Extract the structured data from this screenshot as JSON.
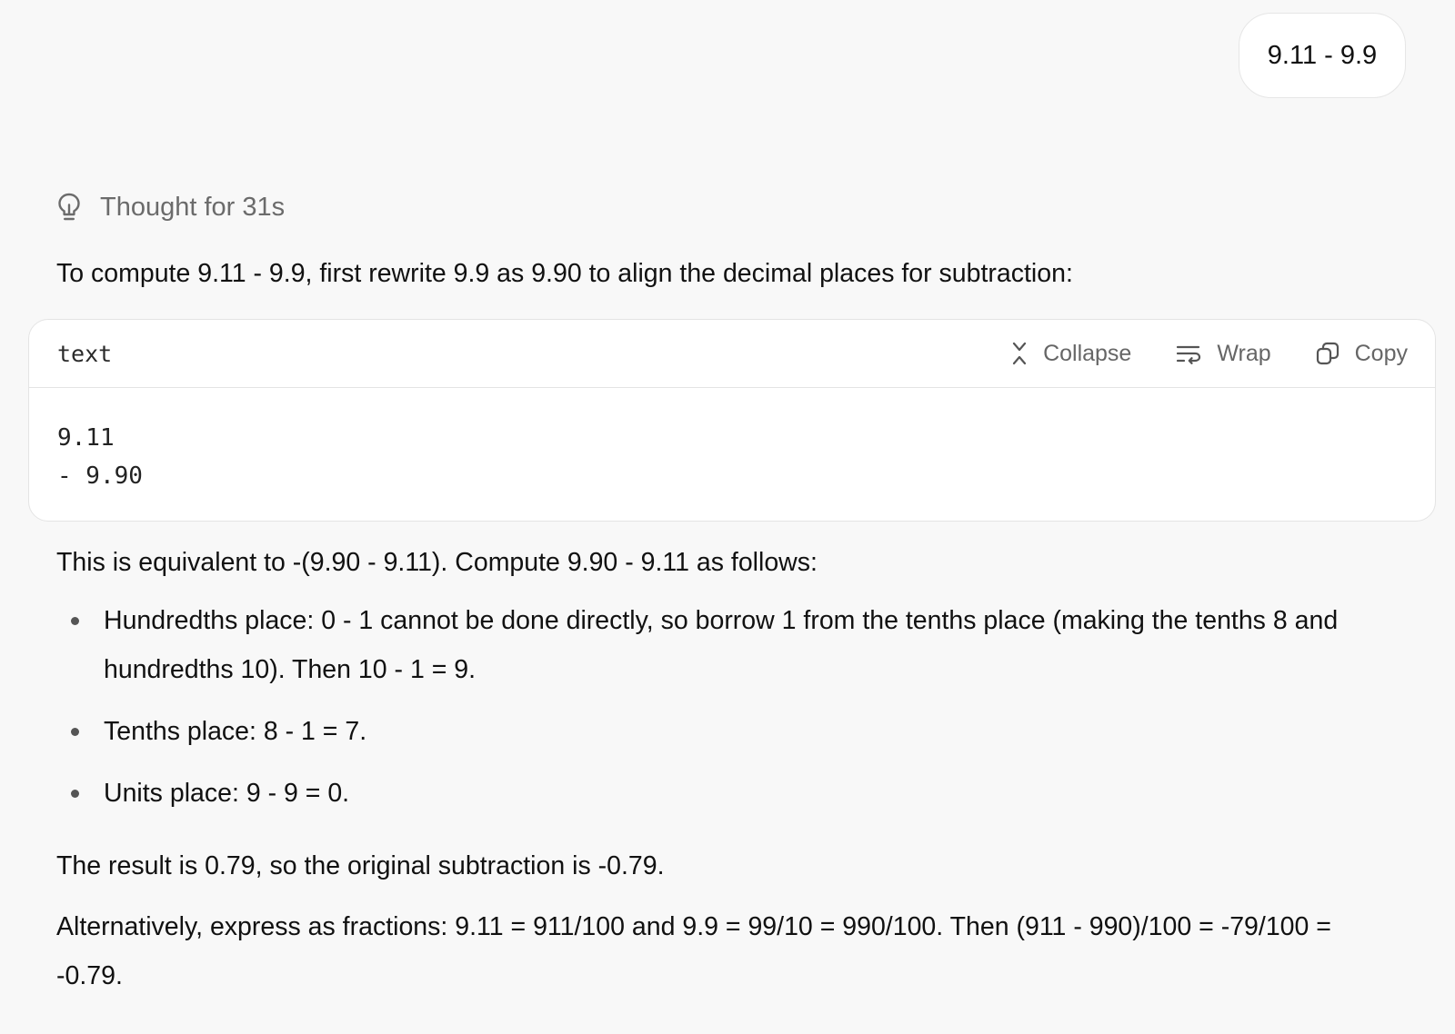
{
  "user_message": "9.11 - 9.9",
  "thought": {
    "icon": "lightbulb-icon",
    "label": "Thought for 31s"
  },
  "response": {
    "intro": "To compute 9.11 - 9.9, first rewrite 9.9 as 9.90 to align the decimal places for subtraction:",
    "code_block": {
      "language": "text",
      "actions": {
        "collapse": "Collapse",
        "wrap": "Wrap",
        "copy": "Copy"
      },
      "lines": [
        "9.11",
        "- 9.90"
      ]
    },
    "equivalence": "This is equivalent to -(9.90 - 9.11). Compute 9.90 - 9.11 as follows:",
    "steps": [
      "Hundredths place: 0 - 1 cannot be done directly, so borrow 1 from the tenths place (making the tenths 8 and hundredths 10). Then 10 - 1 = 9.",
      "Tenths place: 8 - 1 = 7.",
      "Units place: 9 - 9 = 0."
    ],
    "result": "The result is 0.79, so the original subtraction is -0.79.",
    "alternative": "Alternatively, express as fractions: 9.11 = 911/100 and 9.9 = 99/10 = 990/100. Then (911 - 990)/100 = -79/100 = -0.79."
  }
}
